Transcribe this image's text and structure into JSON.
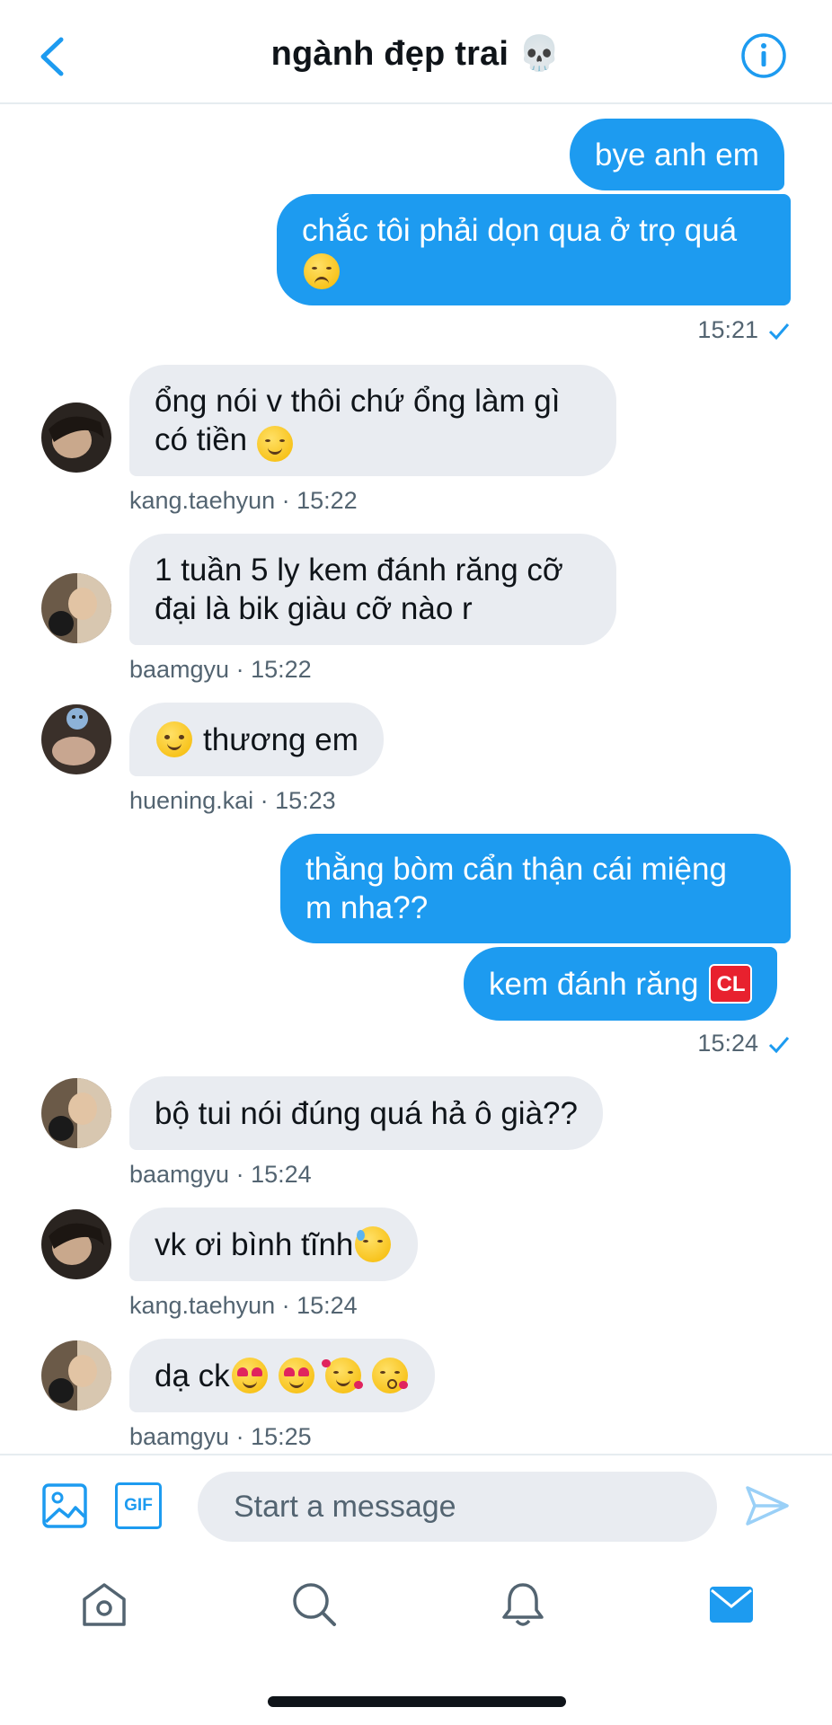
{
  "header": {
    "title": "ngành đẹp trai 💀"
  },
  "messages": {
    "out1": "bye anh em",
    "out2_line1": "chắc tôi phải dọn qua ở trọ quá",
    "out_meta1": "15:21",
    "in1_text": "ổng nói v thôi chứ ổng làm gì\ncó tiền",
    "in1_meta": "kang.taehyun · 15:22",
    "in2_text": "1 tuần 5 ly kem đánh răng cỡ\nđại là bik giàu cỡ nào r",
    "in2_meta": "baamgyu · 15:22",
    "in3_text": "thương em",
    "in3_meta": "huening.kai · 15:23",
    "out3": "thằng bòm cẩn thận cái miệng\nm nha??",
    "out4": "kem đánh răng",
    "out4_badge": "CL",
    "out_meta2": "15:24",
    "in4_text": "bộ tui nói đúng quá hả ô già??",
    "in4_meta": "baamgyu · 15:24",
    "in5_text": "vk ơi bình tĩnh",
    "in5_meta": "kang.taehyun · 15:24",
    "in6_text": "dạ ck",
    "in6_meta": "baamgyu · 15:25"
  },
  "composer": {
    "placeholder": "Start a message",
    "gif_label": "GIF"
  },
  "icons": {
    "back": "chevron-left-icon",
    "info": "info-icon",
    "image": "image-icon",
    "gif": "gif-icon",
    "send": "send-icon",
    "home": "home-icon",
    "search": "search-icon",
    "notifications": "bell-icon",
    "messages": "mail-icon"
  },
  "colors": {
    "accent": "#1d9bf0",
    "bubble_in": "#e9ecf1",
    "meta_text": "#536471"
  }
}
